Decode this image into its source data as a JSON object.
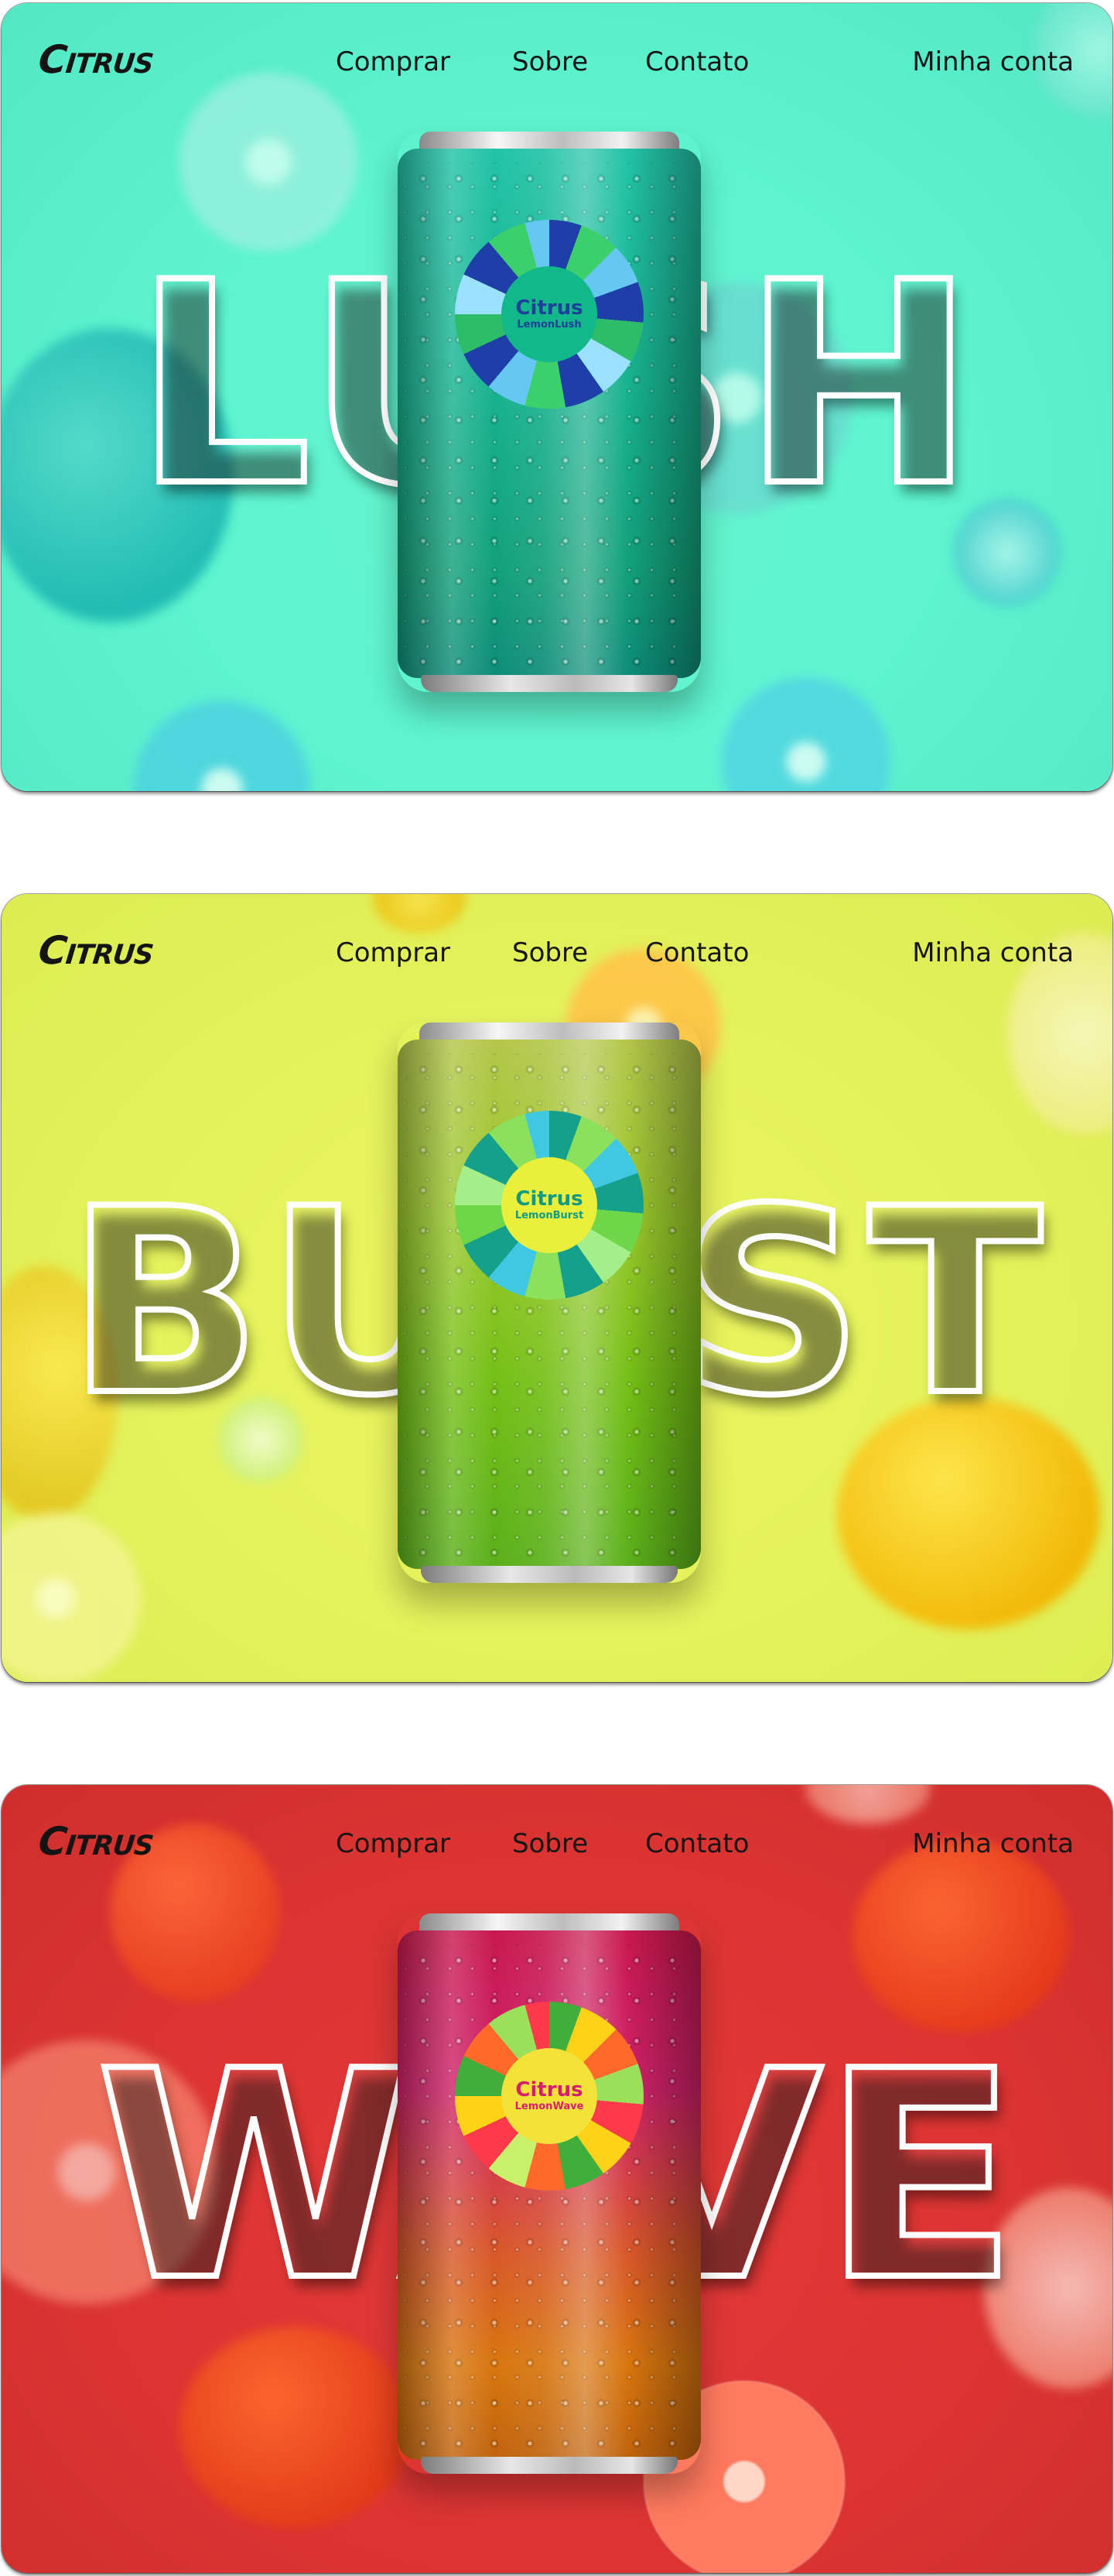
{
  "nav": {
    "logo": "Citrus",
    "links": [
      "Comprar",
      "Sobre",
      "Contato"
    ],
    "account": "Minha conta"
  },
  "panels": [
    {
      "headline": "LUSH",
      "can_brand": "Citrus",
      "can_flavor": "LemonLush",
      "background_color": "#5ef5d0",
      "can_colors": [
        "#1fb7a4",
        "#0f9d73"
      ],
      "accent_color": "#1f3fa8"
    },
    {
      "headline": "BURST",
      "can_brand": "Citrus",
      "can_flavor": "LemonBurst",
      "background_color": "#e4f25c",
      "can_colors": [
        "#a9c43a",
        "#5ab817"
      ],
      "accent_color": "#14a08a"
    },
    {
      "headline": "WAVE",
      "can_brand": "Citrus",
      "can_flavor": "LemonWave",
      "background_color": "#dc3433",
      "can_colors": [
        "#c51a63",
        "#d86a10"
      ],
      "accent_color": "#d51f6e"
    }
  ]
}
